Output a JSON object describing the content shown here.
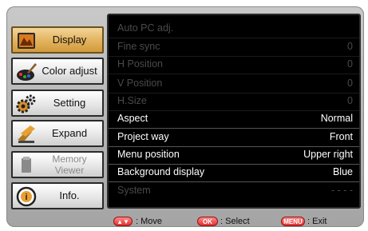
{
  "sidebar": {
    "items": [
      {
        "label": "Display",
        "icon": "display-icon",
        "state": "active"
      },
      {
        "label": "Color adjust",
        "icon": "color-adjust-icon",
        "state": "normal"
      },
      {
        "label": "Setting",
        "icon": "setting-icon",
        "state": "normal"
      },
      {
        "label": "Expand",
        "icon": "expand-icon",
        "state": "normal"
      },
      {
        "label": "Memory Viewer",
        "icon": "memory-viewer-icon",
        "state": "disabled"
      },
      {
        "label": "Info.",
        "icon": "info-icon",
        "state": "normal"
      }
    ]
  },
  "menu": {
    "rows": [
      {
        "label": "Auto PC adj.",
        "value": "",
        "enabled": false
      },
      {
        "label": "Fine sync",
        "value": "0",
        "enabled": false
      },
      {
        "label": "H Position",
        "value": "0",
        "enabled": false
      },
      {
        "label": "V Position",
        "value": "0",
        "enabled": false
      },
      {
        "label": "H.Size",
        "value": "0",
        "enabled": false
      },
      {
        "label": "Aspect",
        "value": "Normal",
        "enabled": true
      },
      {
        "label": "Project way",
        "value": "Front",
        "enabled": true
      },
      {
        "label": "Menu position",
        "value": "Upper right",
        "enabled": true
      },
      {
        "label": "Background display",
        "value": "Blue",
        "enabled": true
      },
      {
        "label": "System",
        "value": "- - - -",
        "enabled": false
      }
    ]
  },
  "footer": {
    "move_key": "▲▼",
    "move_label": ": Move",
    "select_key": "OK",
    "select_label": ": Select",
    "exit_key": "MENU",
    "exit_label": ": Exit"
  },
  "colors": {
    "active_tab": "#e2b25c",
    "panel_bg": "#000000",
    "frame_bg": "#b5b5b5",
    "key_red": "#e23030"
  }
}
